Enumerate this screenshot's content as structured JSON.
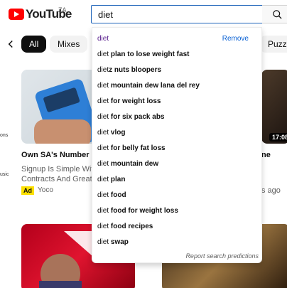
{
  "header": {
    "logo_text": "YouTube",
    "country_code": "ZA",
    "search_value": "diet",
    "search_icon": "search-icon"
  },
  "chips": [
    {
      "label": "All",
      "active": true
    },
    {
      "label": "Mixes",
      "active": false
    },
    {
      "label": "Puzzle",
      "active": false
    }
  ],
  "sidebar_fragments": [
    "ons",
    "usic"
  ],
  "videos": [
    {
      "title": "Own SA's Number 1 C",
      "description_line1": "Signup Is Simple With",
      "description_line2": "Contracts And Great C",
      "ad_badge": "Ad",
      "channel": "Yoco"
    },
    {
      "duration": "17:08",
      "title_fragment": "ne",
      "meta_fragment": "s ago"
    }
  ],
  "suggestions": {
    "history_item": {
      "prefix": "diet",
      "rest": "",
      "remove_label": "Remove"
    },
    "items": [
      {
        "prefix": "diet",
        "rest": " plan to lose weight fast"
      },
      {
        "prefix": "diet",
        "rest": "z nuts bloopers"
      },
      {
        "prefix": "diet",
        "rest": " mountain dew lana del rey"
      },
      {
        "prefix": "diet",
        "rest": " for weight loss"
      },
      {
        "prefix": "diet",
        "rest": " for six pack abs"
      },
      {
        "prefix": "diet",
        "rest": " vlog"
      },
      {
        "prefix": "diet",
        "rest": " for belly fat loss"
      },
      {
        "prefix": "diet",
        "rest": " mountain dew"
      },
      {
        "prefix": "diet",
        "rest": " plan"
      },
      {
        "prefix": "diet",
        "rest": " food"
      },
      {
        "prefix": "diet",
        "rest": " food for weight loss"
      },
      {
        "prefix": "diet",
        "rest": " food recipes"
      },
      {
        "prefix": "diet",
        "rest": " swap"
      }
    ],
    "report_label": "Report search predictions"
  },
  "colors": {
    "brand_red": "#ff0000",
    "link_blue": "#065fd4",
    "history_purple": "#551a8b",
    "ad_yellow": "#fce000"
  }
}
